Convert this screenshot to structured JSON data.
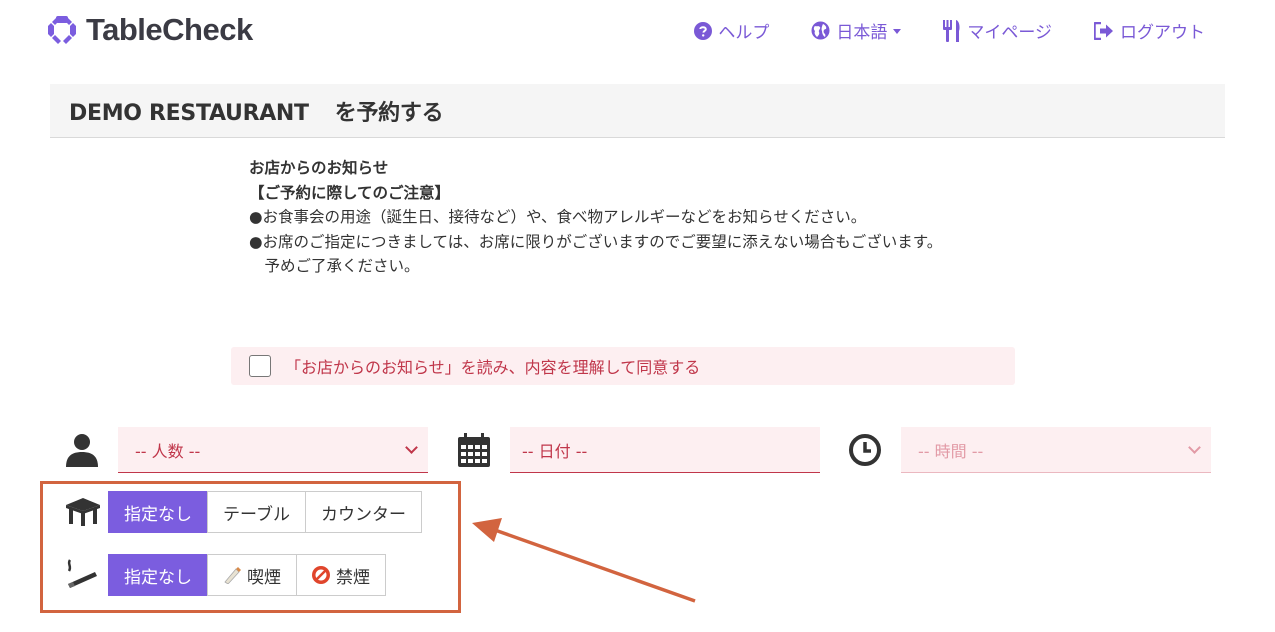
{
  "brand": {
    "name": "TableCheck",
    "accent": "#7b5ddf",
    "alert": "#c0364a"
  },
  "nav": {
    "help": "ヘルプ",
    "language": "日本語",
    "mypage": "マイページ",
    "logout": "ログアウト"
  },
  "header": {
    "restaurant": "DEMO RESTAURANT",
    "action": "を予約する"
  },
  "notice": {
    "title": "お店からのお知らせ",
    "heading": "【ご予約に際してのご注意】",
    "line1": "●お食事会の用途（誕生日、接待など）や、食べ物アレルギーなどをお知らせください。",
    "line2": "●お席のご指定につきましては、お席に限りがございますのでご要望に添えない場合もございます。",
    "line3": "　予めご了承ください。"
  },
  "agreement": {
    "label": "「お店からのお知らせ」を読み、内容を理解して同意する",
    "checked": false
  },
  "fields": {
    "people": "-- 人数 --",
    "date": "-- 日付 --",
    "time": "-- 時間 --"
  },
  "seat_options": {
    "icon": "table-icon",
    "items": [
      "指定なし",
      "テーブル",
      "カウンター"
    ],
    "selected": "指定なし"
  },
  "smoking_options": {
    "icon": "cigarette-icon",
    "items": [
      "指定なし",
      "喫煙",
      "禁煙"
    ],
    "selected": "指定なし"
  }
}
